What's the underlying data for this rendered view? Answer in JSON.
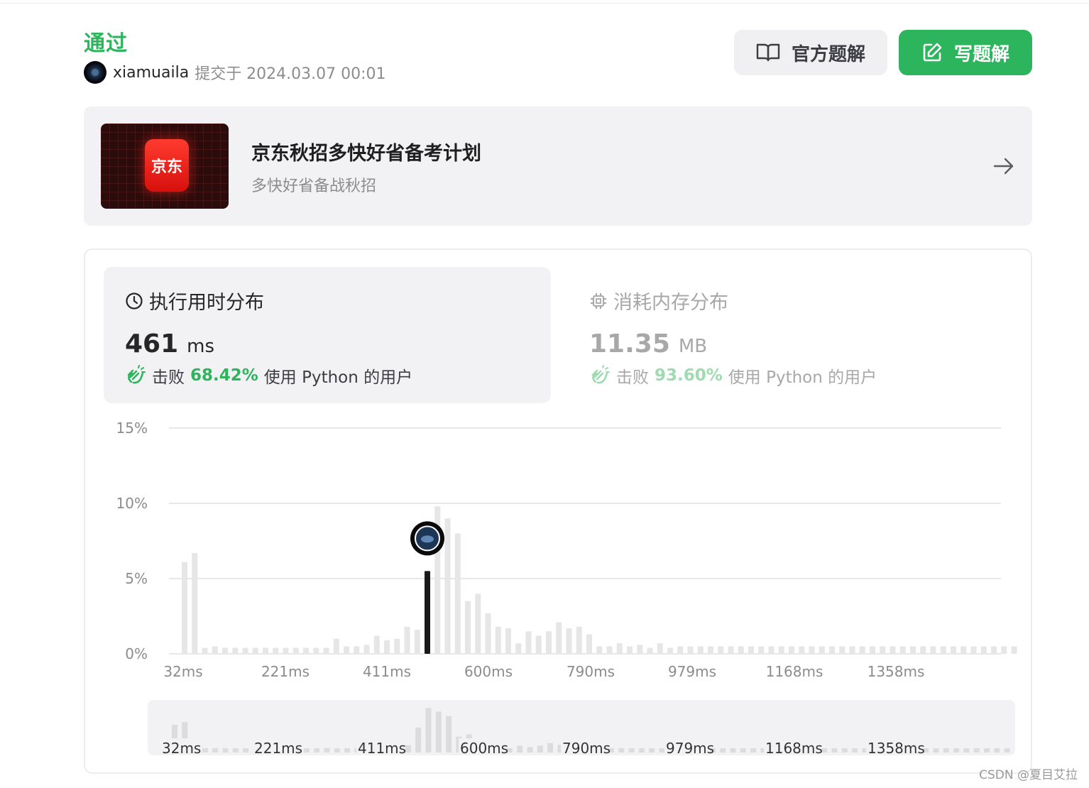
{
  "status": "通过",
  "submission": {
    "username": "xiamuaila",
    "submitted_at": "提交于 2024.03.07 00:01"
  },
  "buttons": {
    "official_solution": "官方题解",
    "write_solution": "写题解"
  },
  "promo": {
    "logo_text": "京东",
    "title": "京东秋招多快好省备考计划",
    "subtitle": "多快好省备战秋招"
  },
  "runtime": {
    "label": "执行用时分布",
    "value": "461",
    "unit": "ms",
    "beat_prefix": "击败",
    "beat_percent": "68.42%",
    "beat_suffix": "使用 Python 的用户"
  },
  "memory": {
    "label": "消耗内存分布",
    "value": "11.35",
    "unit": "MB",
    "beat_prefix": "击败",
    "beat_percent": "93.60%",
    "beat_suffix": "使用 Python 的用户"
  },
  "watermark": "CSDN @夏目艾拉",
  "colors": {
    "accent_green": "#2db55d",
    "bar_gray": "#e6e6e6",
    "highlight_bar": "#1a1a1a"
  },
  "chart_data": {
    "type": "bar",
    "x_label_ticks": [
      "32ms",
      "221ms",
      "411ms",
      "600ms",
      "790ms",
      "979ms",
      "1168ms",
      "1358ms"
    ],
    "y_ticks": [
      "0%",
      "5%",
      "10%",
      "15%"
    ],
    "ylim": [
      0,
      15
    ],
    "values": [
      6.1,
      6.7,
      0.4,
      0.5,
      0.4,
      0.4,
      0.4,
      0.4,
      0.4,
      0.4,
      0.4,
      0.4,
      0.4,
      0.4,
      0.4,
      1.0,
      0.5,
      0.5,
      0.6,
      1.2,
      0.9,
      1.0,
      1.8,
      1.6,
      5.5,
      9.8,
      9.0,
      8.0,
      3.5,
      4.0,
      2.7,
      1.8,
      1.7,
      0.7,
      1.5,
      1.2,
      1.5,
      2.1,
      1.7,
      1.8,
      1.3,
      0.5,
      0.5,
      0.7,
      0.5,
      0.6,
      0.4,
      0.7,
      0.4,
      0.5,
      0.5,
      0.5,
      0.5,
      0.5,
      0.5,
      0.5,
      0.5,
      0.5,
      0.5,
      0.5,
      0.5,
      0.5,
      0.5,
      0.5,
      0.5,
      0.5,
      0.5,
      0.5,
      0.5,
      0.5,
      0.5,
      0.5,
      0.5,
      0.5,
      0.5,
      0.5,
      0.5,
      0.5,
      0.5,
      0.5,
      0.5,
      0.5,
      0.5
    ],
    "highlight_index": 24,
    "grid": true
  }
}
